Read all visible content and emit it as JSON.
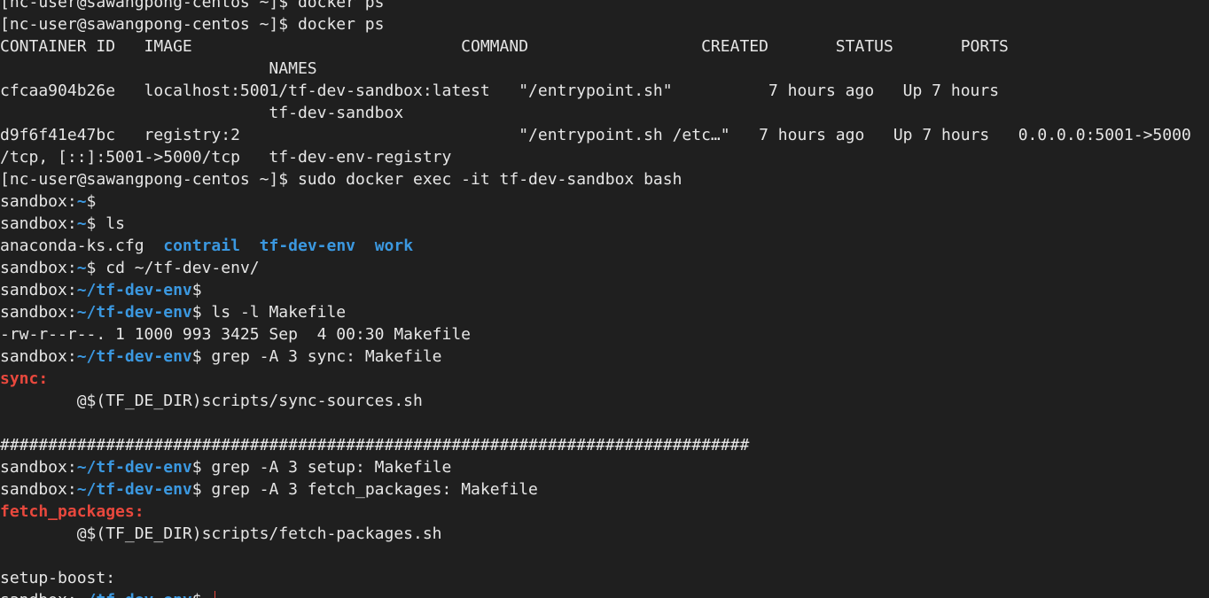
{
  "terminal": {
    "lines": [
      {
        "type": "text",
        "text": "[nc-user@sawangpong-centos ~]$ docker ps"
      },
      {
        "type": "text",
        "text": "[nc-user@sawangpong-centos ~]$ docker ps"
      },
      {
        "type": "text",
        "text": "CONTAINER ID   IMAGE                            COMMAND                  CREATED       STATUS       PORTS"
      },
      {
        "type": "text",
        "text": "                            NAMES"
      },
      {
        "type": "text",
        "text": "cfcaa904b26e   localhost:5001/tf-dev-sandbox:latest   \"/entrypoint.sh\"          7 hours ago   Up 7 hours"
      },
      {
        "type": "text",
        "text": "                            tf-dev-sandbox"
      },
      {
        "type": "text",
        "text": "d9f6f41e47bc   registry:2                             \"/entrypoint.sh /etc…\"   7 hours ago   Up 7 hours   0.0.0.0:5001->5000"
      },
      {
        "type": "text",
        "text": "/tcp, [::]:5001->5000/tcp   tf-dev-env-registry"
      },
      {
        "type": "text",
        "text": "[nc-user@sawangpong-centos ~]$ sudo docker exec -it tf-dev-sandbox bash"
      },
      {
        "type": "prompt",
        "host": "sandbox:",
        "path": "~",
        "sym": "$",
        "cmd": ""
      },
      {
        "type": "prompt",
        "host": "sandbox:",
        "path": "~",
        "sym": "$",
        "cmd": " ls"
      },
      {
        "type": "ls",
        "file": "anaconda-ks.cfg",
        "dirs": [
          "contrail",
          "tf-dev-env",
          "work"
        ]
      },
      {
        "type": "prompt",
        "host": "sandbox:",
        "path": "~",
        "sym": "$",
        "cmd": " cd ~/tf-dev-env/"
      },
      {
        "type": "prompt",
        "host": "sandbox:",
        "path": "~/tf-dev-env",
        "sym": "$",
        "cmd": ""
      },
      {
        "type": "prompt",
        "host": "sandbox:",
        "path": "~/tf-dev-env",
        "sym": "$",
        "cmd": " ls -l Makefile"
      },
      {
        "type": "text",
        "text": "-rw-r--r--. 1 1000 993 3425 Sep  4 00:30 Makefile"
      },
      {
        "type": "prompt",
        "host": "sandbox:",
        "path": "~/tf-dev-env",
        "sym": "$",
        "cmd": " grep -A 3 sync: Makefile"
      },
      {
        "type": "target",
        "text": "sync:"
      },
      {
        "type": "text",
        "text": "        @$(TF_DE_DIR)scripts/sync-sources.sh"
      },
      {
        "type": "text",
        "text": ""
      },
      {
        "type": "text",
        "text": "##############################################################################"
      },
      {
        "type": "prompt",
        "host": "sandbox:",
        "path": "~/tf-dev-env",
        "sym": "$",
        "cmd": " grep -A 3 setup: Makefile"
      },
      {
        "type": "prompt",
        "host": "sandbox:",
        "path": "~/tf-dev-env",
        "sym": "$",
        "cmd": " grep -A 3 fetch_packages: Makefile"
      },
      {
        "type": "target",
        "text": "fetch_packages:"
      },
      {
        "type": "text",
        "text": "        @$(TF_DE_DIR)scripts/fetch-packages.sh"
      },
      {
        "type": "text",
        "text": ""
      },
      {
        "type": "text",
        "text": "setup-boost:"
      },
      {
        "type": "prompt",
        "host": "sandbox:",
        "path": "~/tf-dev-env",
        "sym": "$",
        "cmd": " ",
        "cursor": true
      }
    ]
  },
  "colors": {
    "background": "#1f1f1f",
    "foreground": "#e6e6e6",
    "path_blue": "#3b98e0",
    "target_red": "#e8483d"
  }
}
